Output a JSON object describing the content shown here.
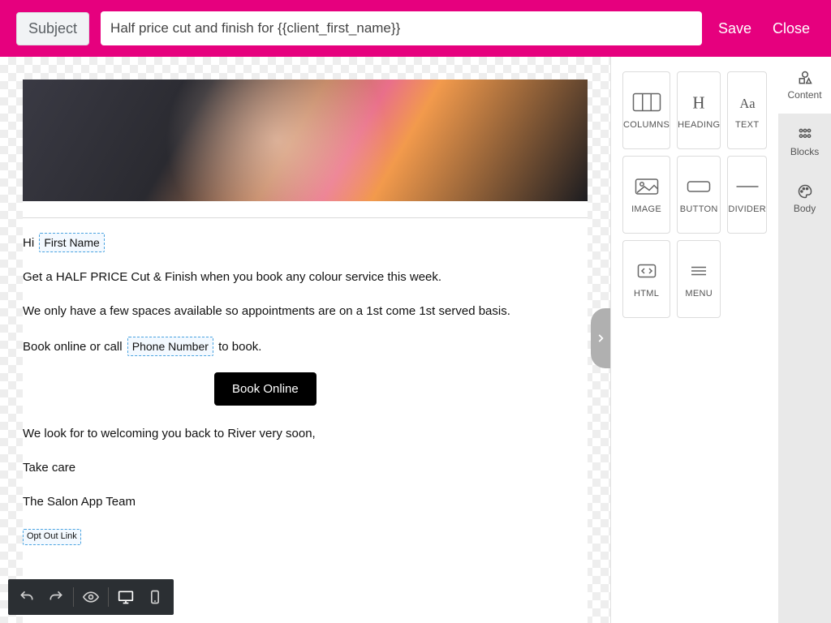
{
  "header": {
    "subject_label": "Subject",
    "subject_value": "Half price cut and finish for {{client_first_name}}",
    "save": "Save",
    "close": "Close"
  },
  "email": {
    "greeting_pre": "Hi ",
    "greeting_tag": "First Name",
    "line1": "Get a HALF PRICE Cut & Finish when you book any colour service this week.",
    "line2": "We only have a few spaces available so appointments are on a 1st come 1st served basis.",
    "line3_pre": "Book online or call ",
    "line3_tag": "Phone Number",
    "line3_post": " to book.",
    "cta": "Book Online",
    "line4": "We look for to welcoming you back to River very soon,",
    "line5": "Take care",
    "line6": "The Salon App Team",
    "optout_tag": "Opt Out Link"
  },
  "sidebar": {
    "tiles": {
      "columns": "COLUMNS",
      "heading": "HEADING",
      "text": "TEXT",
      "image": "IMAGE",
      "button": "BUTTON",
      "divider": "DIVIDER",
      "html": "HTML",
      "menu": "MENU"
    },
    "tabs": {
      "content": "Content",
      "blocks": "Blocks",
      "body": "Body"
    }
  }
}
